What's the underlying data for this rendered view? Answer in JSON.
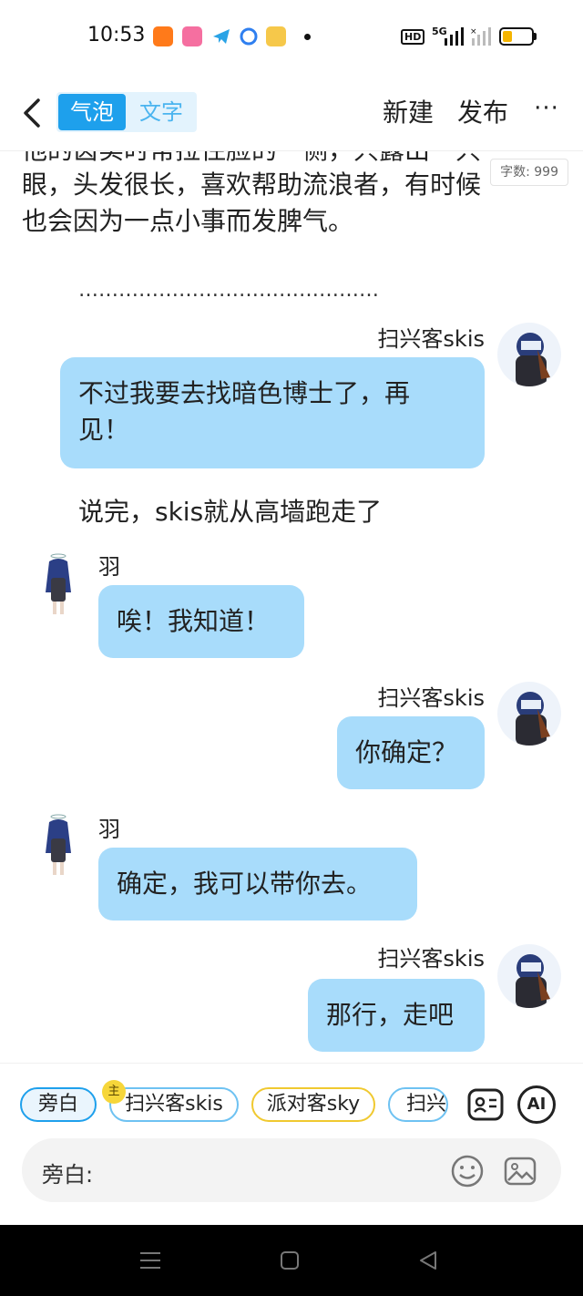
{
  "status_bar": {
    "time": "10:53",
    "hd_label": "HD",
    "net_label": "5G",
    "app_icons": [
      "taobao-icon",
      "bilibili-icon",
      "telegram-icon",
      "browser-icon",
      "notes-icon"
    ]
  },
  "header": {
    "mode_bubble": "气泡",
    "mode_text": "文字",
    "new_label": "新建",
    "publish_label": "发布",
    "more_label": "···"
  },
  "story": {
    "para_lines": [
      "他的齿实时常拉住脸的一侧，只露出一只",
      "眼，头发很长，喜欢帮助流浪者，有时候",
      "也会因为一点小事而发脾气。"
    ],
    "word_count": "字数: 999",
    "ellipsis": "………………………………………"
  },
  "messages": [
    {
      "speaker": "扫兴客skis",
      "side": "right",
      "text_lines": [
        "不过我要去找暗色博士了，再",
        "见！"
      ]
    },
    {
      "speaker": "",
      "side": "narration",
      "text_lines": [
        "说完，skis就从高墙跑走了"
      ]
    },
    {
      "speaker": "羽",
      "side": "left",
      "text_lines": [
        "唉！我知道！"
      ]
    },
    {
      "speaker": "扫兴客skis",
      "side": "right",
      "text_lines": [
        "你确定？"
      ]
    },
    {
      "speaker": "羽",
      "side": "left",
      "text_lines": [
        "确定，我可以带你去。"
      ]
    },
    {
      "speaker": "扫兴客skis",
      "side": "right",
      "text_lines": [
        "那行，走吧"
      ]
    }
  ],
  "input": {
    "chips": [
      "旁白",
      "扫兴客skis",
      "派对客sky",
      "扫兴"
    ],
    "host_badge": "主",
    "ai_label": "AI",
    "field_label": "旁白:"
  },
  "colors": {
    "accent": "#1ea0ec",
    "bubble": "#a8dcfb",
    "chip_yellow": "#f0c930"
  }
}
